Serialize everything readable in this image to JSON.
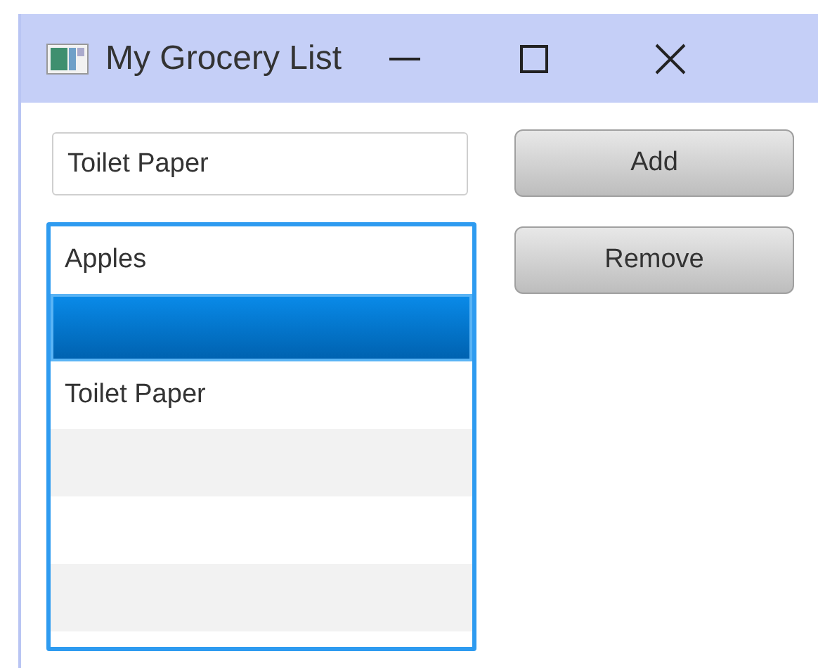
{
  "window": {
    "title": "My Grocery List"
  },
  "input": {
    "value": "Toilet Paper"
  },
  "buttons": [
    {
      "label": "Add"
    },
    {
      "label": "Remove"
    }
  ],
  "list": {
    "items": [
      {
        "text": "Apples",
        "selected": false
      },
      {
        "selected": true
      },
      {
        "text": "Toilet Paper",
        "selected": false
      }
    ]
  }
}
